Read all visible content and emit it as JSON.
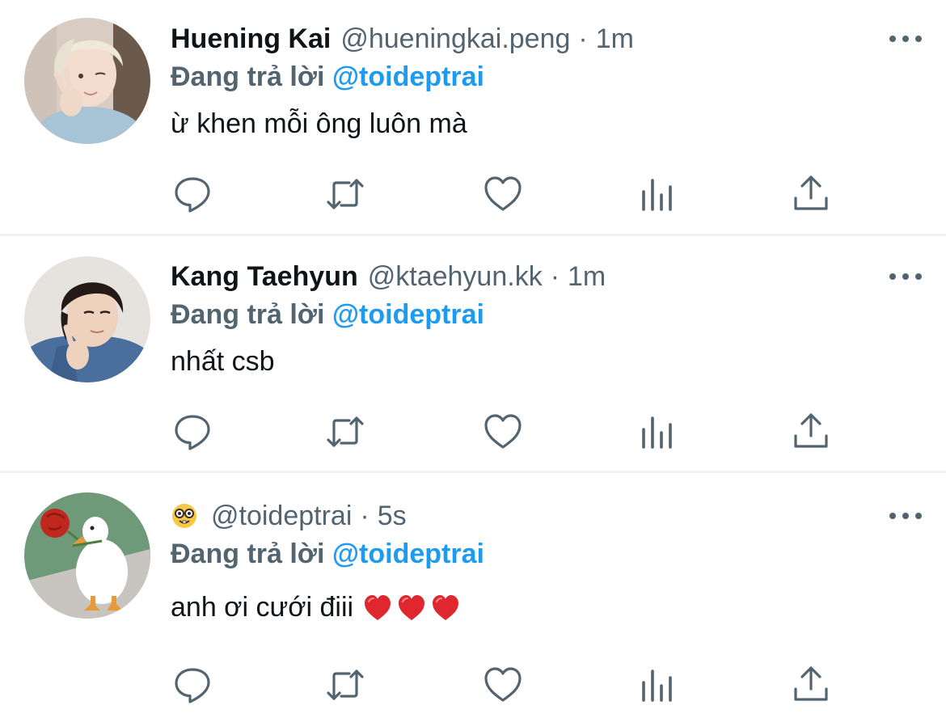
{
  "tweets": [
    {
      "name": "Huening Kai",
      "handle": "@hueningkai.peng",
      "separator": "·",
      "time": "1m",
      "reply_prefix": "Đang trả lời",
      "reply_mention": "@toideptrai",
      "text": "ừ khen mỗi ông luôn mà",
      "avatar": "avatar-photo-blonde"
    },
    {
      "name": "Kang Taehyun",
      "handle": "@ktaehyun.kk",
      "separator": "·",
      "time": "1m",
      "reply_prefix": "Đang trả lời",
      "reply_mention": "@toideptrai",
      "text": "nhất csb",
      "avatar": "avatar-photo-denim"
    },
    {
      "name_emoji": "nerd-face-emoji",
      "handle": "@toideptrai",
      "separator": "·",
      "time": "5s",
      "reply_prefix": "Đang trả lời",
      "reply_mention": "@toideptrai",
      "text": "anh ơi cưới điii",
      "text_emojis": [
        "red-heart-emoji",
        "red-heart-emoji",
        "red-heart-emoji"
      ],
      "avatar": "avatar-goose-with-rose"
    }
  ],
  "actions": [
    "reply-icon",
    "retweet-icon",
    "like-icon",
    "analytics-icon",
    "share-icon"
  ],
  "colors": {
    "text": "#0f1419",
    "secondary": "#536471",
    "mention": "#1d9bf0",
    "divider": "#eff3f4"
  }
}
